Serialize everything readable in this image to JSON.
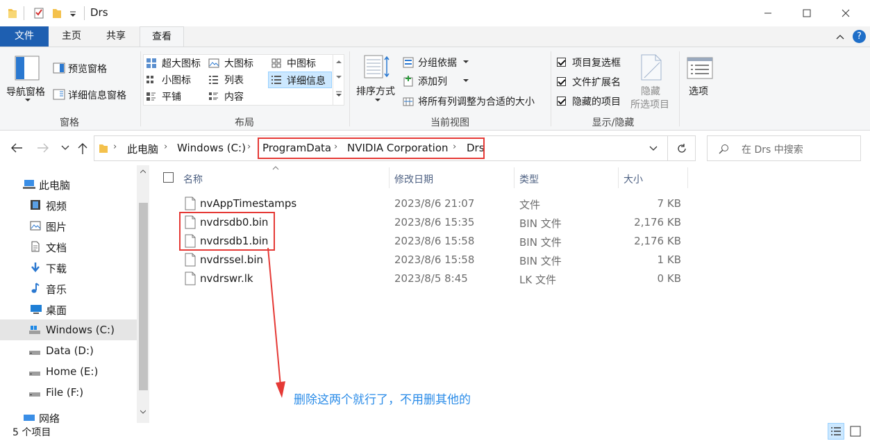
{
  "window": {
    "title": "Drs"
  },
  "tabs": {
    "file": "文件",
    "home": "主页",
    "share": "共享",
    "view": "查看"
  },
  "ribbon": {
    "panes": {
      "nav_pane": "导航窗格",
      "preview_pane": "预览窗格",
      "details_pane": "详细信息窗格",
      "label": "窗格"
    },
    "layout": {
      "extra_large": "超大图标",
      "large": "大图标",
      "medium": "中图标",
      "small": "小图标",
      "list": "列表",
      "details": "详细信息",
      "tiles": "平铺",
      "content": "内容",
      "label": "布局"
    },
    "current_view": {
      "sort_by": "排序方式",
      "group_by": "分组依据",
      "add_columns": "添加列",
      "size_all_columns": "将所有列调整为合适的大小",
      "label": "当前视图"
    },
    "show_hide": {
      "item_checkboxes": "项目复选框",
      "file_extensions": "文件扩展名",
      "hidden_items": "隐藏的项目",
      "hide_selected_1": "隐藏",
      "hide_selected_2": "所选项目",
      "label": "显示/隐藏"
    },
    "options": "选项"
  },
  "address": {
    "crumbs": [
      "此电脑",
      "Windows (C:)",
      "ProgramData",
      "NVIDIA Corporation",
      "Drs"
    ],
    "search_placeholder": "在 Drs 中搜索"
  },
  "nav": {
    "items": [
      {
        "label": "此电脑",
        "icon": "computer-icon"
      },
      {
        "label": "视频",
        "icon": "video-icon"
      },
      {
        "label": "图片",
        "icon": "pictures-icon"
      },
      {
        "label": "文档",
        "icon": "documents-icon"
      },
      {
        "label": "下载",
        "icon": "download-icon"
      },
      {
        "label": "音乐",
        "icon": "music-icon"
      },
      {
        "label": "桌面",
        "icon": "desktop-icon"
      },
      {
        "label": "Windows (C:)",
        "icon": "drive-c-icon"
      },
      {
        "label": "Data (D:)",
        "icon": "drive-icon"
      },
      {
        "label": "Home (E:)",
        "icon": "drive-icon"
      },
      {
        "label": "File (F:)",
        "icon": "drive-icon"
      },
      {
        "label": "网络",
        "icon": "network-icon"
      }
    ]
  },
  "columns": {
    "name": "名称",
    "date": "修改日期",
    "type": "类型",
    "size": "大小"
  },
  "files": [
    {
      "name": "nvAppTimestamps",
      "date": "2023/8/6 21:07",
      "type": "文件",
      "size": "7 KB"
    },
    {
      "name": "nvdrsdb0.bin",
      "date": "2023/8/6 15:35",
      "type": "BIN 文件",
      "size": "2,176 KB"
    },
    {
      "name": "nvdrsdb1.bin",
      "date": "2023/8/6 15:58",
      "type": "BIN 文件",
      "size": "2,176 KB"
    },
    {
      "name": "nvdrssel.bin",
      "date": "2023/8/6 15:58",
      "type": "BIN 文件",
      "size": "1 KB"
    },
    {
      "name": "nvdrswr.lk",
      "date": "2023/8/5 8:45",
      "type": "LK 文件",
      "size": "0 KB"
    }
  ],
  "status": {
    "count": "5 个项目"
  },
  "annotation": {
    "text": "删除这两个就行了，不用删其他的"
  },
  "colors": {
    "accent": "#1e5fb1",
    "highlight": "#e53935",
    "annotation": "#2b8ce8",
    "selected": "#cce8ff"
  }
}
